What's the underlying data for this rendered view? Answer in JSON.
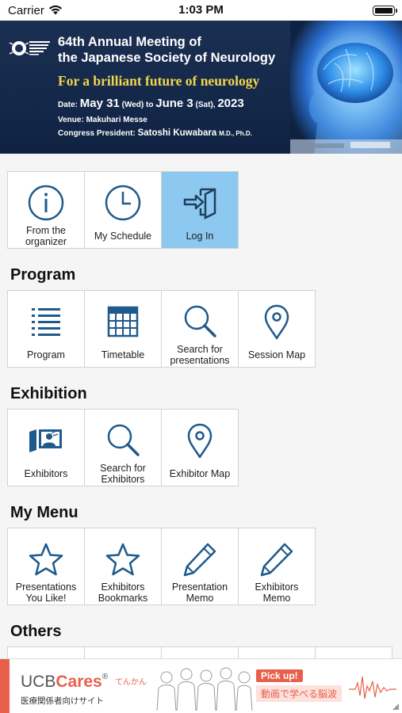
{
  "status": {
    "carrier": "Carrier",
    "time": "1:03 PM"
  },
  "banner": {
    "title_line1": "64th Annual Meeting of",
    "title_line2": "the Japanese Society of Neurology",
    "tagline": "For a brilliant future of neurology",
    "date_prefix": "Date:",
    "date_start": "May 31",
    "date_start_day": "(Wed)",
    "date_to": "to",
    "date_end": "June 3",
    "date_end_day": "(Sat),",
    "date_year": "2023",
    "venue": "Venue: Makuhari Messe",
    "president_prefix": "Congress President:",
    "president_name": "Satoshi Kuwabara",
    "president_degree": "M.D., Ph.D."
  },
  "top_tiles": {
    "organizer": {
      "label_line1": "From the",
      "label_line2": "organizer",
      "icon": "info-icon"
    },
    "schedule": {
      "label": "My Schedule",
      "icon": "clock-icon"
    },
    "login": {
      "label": "Log In",
      "icon": "login-icon"
    }
  },
  "sections": {
    "program": {
      "title": "Program",
      "tiles": {
        "program": {
          "label": "Program",
          "icon": "list-icon"
        },
        "timetable": {
          "label": "Timetable",
          "icon": "calendar-icon"
        },
        "search": {
          "label_line1": "Search for",
          "label_line2": "presentations",
          "icon": "search-icon"
        },
        "map": {
          "label": "Session Map",
          "icon": "map-pin-icon"
        }
      }
    },
    "exhibition": {
      "title": "Exhibition",
      "tiles": {
        "exhibitors": {
          "label": "Exhibitors",
          "icon": "exhibitor-icon"
        },
        "search": {
          "label_line1": "Search for",
          "label_line2": "Exhibitors",
          "icon": "search-icon"
        },
        "map": {
          "label": "Exhibitor Map",
          "icon": "map-pin-icon"
        }
      }
    },
    "my_menu": {
      "title": "My Menu",
      "tiles": {
        "liked": {
          "label_line1": "Presentations",
          "label_line2": "You Like!",
          "icon": "star-icon"
        },
        "bookmarks": {
          "label_line1": "Exhibitors",
          "label_line2": "Bookmarks",
          "icon": "star-icon"
        },
        "pres_memo": {
          "label_line1": "Presentation",
          "label_line2": "Memo",
          "icon": "pencil-icon"
        },
        "exh_memo": {
          "label_line1": "Exhibitors",
          "label_line2": "Memo",
          "icon": "pencil-icon"
        }
      }
    },
    "others": {
      "title": "Others"
    }
  },
  "ad": {
    "brand_prefix": "UCB",
    "brand_suffix": "Cares",
    "brand_mark": "®",
    "tenkan": "てんかん",
    "subtitle": "医療関係者向けサイト",
    "pick_up": "Pick up!",
    "headline": "動画で学べる脳波"
  },
  "colors": {
    "icon_blue": "#1f5a8c",
    "active_tile": "#8cc8f0",
    "banner_bg": "#14284a",
    "tagline_gold": "#f2d64b",
    "ad_accent": "#e8604c"
  }
}
